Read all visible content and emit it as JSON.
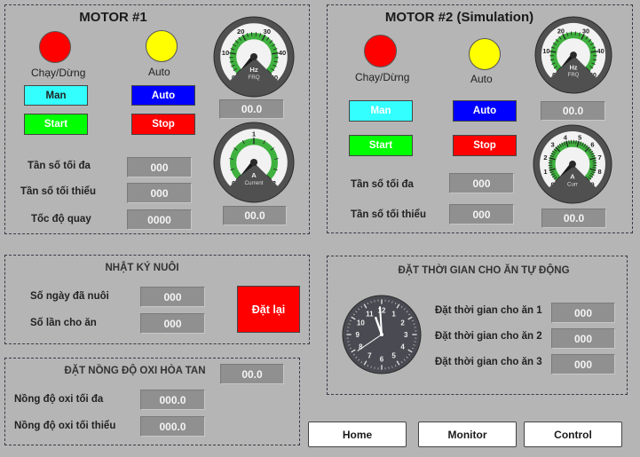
{
  "motor1": {
    "title": "MOTOR #1",
    "lamp_run_label": "Chạy/Dừng",
    "lamp_auto_label": "Auto",
    "btn_man": "Man",
    "btn_auto": "Auto",
    "btn_start": "Start",
    "btn_stop": "Stop",
    "freq_max_label": "Tần số tối đa",
    "freq_min_label": "Tần số tối thiểu",
    "speed_label": "Tốc độ quay",
    "freq_max_value": "000",
    "freq_min_value": "000",
    "speed_value": "0000",
    "gauge_freq": {
      "ticks": [
        "0",
        "10",
        "20",
        "30",
        "40",
        "50"
      ],
      "unit": "Hz",
      "sub": "FRQ",
      "value": 0
    },
    "gauge_freq_value": "00.0",
    "gauge_current": {
      "ticks": [
        "0",
        "1",
        "2"
      ],
      "unit": "A",
      "sub": "Current",
      "value": 0
    },
    "gauge_current_value": "00.0"
  },
  "motor2": {
    "title": "MOTOR #2 (Simulation)",
    "lamp_run_label": "Chạy/Dừng",
    "lamp_auto_label": "Auto",
    "btn_man": "Man",
    "btn_auto": "Auto",
    "btn_start": "Start",
    "btn_stop": "Stop",
    "freq_max_label": "Tần số tối đa",
    "freq_min_label": "Tần số tối thiểu",
    "freq_max_value": "000",
    "freq_min_value": "000",
    "gauge_freq": {
      "ticks": [
        "0",
        "10",
        "20",
        "30",
        "40",
        "50"
      ],
      "unit": "Hz",
      "sub": "FRQ",
      "value": 0
    },
    "gauge_freq_value": "00.0",
    "gauge_current": {
      "ticks": [
        "0",
        "1",
        "2",
        "3",
        "4",
        "5",
        "6",
        "7",
        "8",
        "9"
      ],
      "unit": "A",
      "sub": "Curr",
      "value": 0
    },
    "gauge_current_value": "00.0"
  },
  "log": {
    "title": "NHẬT KÝ NUÔI",
    "days_label": "Số ngày đã nuôi",
    "feeds_label": "Số lần cho ăn",
    "days_value": "000",
    "feeds_value": "000",
    "reset_label": "Đặt lại"
  },
  "oxygen": {
    "title": "ĐẶT NỒNG ĐỘ OXI HÒA TAN",
    "current_value": "00.0",
    "max_label": "Nồng độ oxi tối đa",
    "min_label": "Nồng độ oxi tối thiểu",
    "max_value": "000.0",
    "min_value": "000.0"
  },
  "feeding": {
    "title": "ĐẶT THỜI GIAN CHO ĂN TỰ ĐỘNG",
    "t1_label": "Đặt thời gian cho ăn 1",
    "t2_label": "Đặt thời gian cho ăn 2",
    "t3_label": "Đặt thời gian cho ăn 3",
    "t1_value": "000",
    "t2_value": "000",
    "t3_value": "000",
    "clock_numbers": [
      "12",
      "1",
      "2",
      "3",
      "4",
      "5",
      "6",
      "7",
      "8",
      "9",
      "10",
      "11"
    ]
  },
  "nav": {
    "home": "Home",
    "monitor": "Monitor",
    "control": "Control"
  },
  "colors": {
    "lamp_run": "#ff0000",
    "lamp_auto": "#ffff00",
    "man": "#33ffff",
    "auto": "#0000ff",
    "start": "#00ff00",
    "stop": "#ff0000"
  }
}
